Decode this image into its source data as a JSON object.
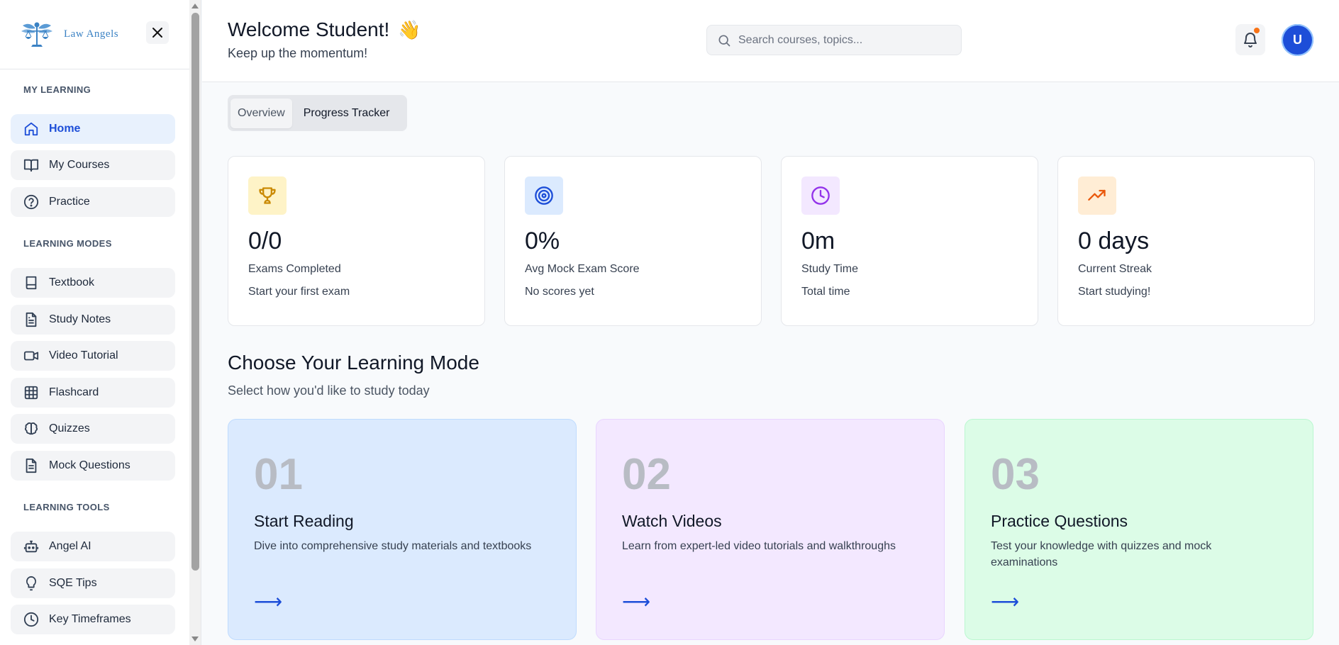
{
  "sidebar": {
    "logo_text": "Law Angels",
    "sections": [
      {
        "label": "MY LEARNING"
      },
      {
        "label": "LEARNING MODES"
      },
      {
        "label": "LEARNING TOOLS"
      }
    ],
    "items": [
      {
        "label": "Home",
        "icon": "home-icon",
        "active": true
      },
      {
        "label": "My Courses",
        "icon": "book-open-icon"
      },
      {
        "label": "Practice",
        "icon": "help-circle-icon"
      },
      {
        "label": "Textbook",
        "icon": "book-icon"
      },
      {
        "label": "Study Notes",
        "icon": "file-text-icon"
      },
      {
        "label": "Video Tutorial",
        "icon": "video-icon"
      },
      {
        "label": "Flashcard",
        "icon": "grid-icon"
      },
      {
        "label": "Quizzes",
        "icon": "brain-icon"
      },
      {
        "label": "Mock Questions",
        "icon": "file-lines-icon"
      },
      {
        "label": "Angel AI",
        "icon": "bot-icon"
      },
      {
        "label": "SQE Tips",
        "icon": "lightbulb-icon"
      },
      {
        "label": "Key Timeframes",
        "icon": "clock-icon"
      }
    ]
  },
  "header": {
    "title": "Welcome Student!",
    "emoji": "👋",
    "subtitle": "Keep up the momentum!",
    "search_placeholder": "Search courses, topics...",
    "avatar_initial": "U"
  },
  "tabs": [
    {
      "label": "Overview",
      "active": true
    },
    {
      "label": "Progress Tracker"
    }
  ],
  "stats": [
    {
      "value": "0/0",
      "label": "Exams Completed",
      "note": "Start your first exam",
      "icon": "trophy-icon",
      "icon_bg": "#fef3c7",
      "icon_color": "#ca8a04"
    },
    {
      "value": "0%",
      "label": "Avg Mock Exam Score",
      "note": "No scores yet",
      "icon": "target-icon",
      "icon_bg": "#dbeafe",
      "icon_color": "#1d4ed8"
    },
    {
      "value": "0m",
      "label": "Study Time",
      "note": "Total time",
      "icon": "clock-icon",
      "icon_bg": "#f3e8ff",
      "icon_color": "#9333ea"
    },
    {
      "value": "0 days",
      "label": "Current Streak",
      "note": "Start studying!",
      "icon": "trending-up-icon",
      "icon_bg": "#ffedd5",
      "icon_color": "#ea580c"
    }
  ],
  "learning": {
    "title": "Choose Your Learning Mode",
    "subtitle": "Select how you'd like to study today",
    "modes": [
      {
        "num": "01",
        "title": "Start Reading",
        "desc": "Dive into comprehensive study materials and textbooks",
        "bg": "#dbeafe",
        "border": "#bfdbfe"
      },
      {
        "num": "02",
        "title": "Watch Videos",
        "desc": "Learn from expert-led video tutorials and walkthroughs",
        "bg": "#f3e8ff",
        "border": "#e9d5ff"
      },
      {
        "num": "03",
        "title": "Practice Questions",
        "desc": "Test your knowledge with quizzes and mock examinations",
        "bg": "#dcfce7",
        "border": "#bbf7d0"
      }
    ],
    "arrow": "⟶"
  }
}
